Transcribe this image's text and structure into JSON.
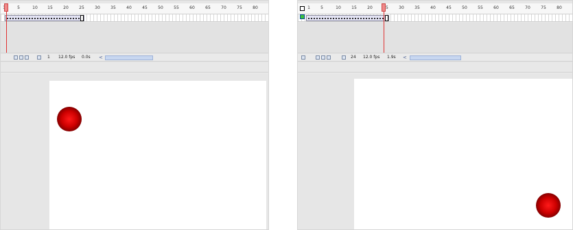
{
  "timeline": {
    "ruler_labels": [
      "1",
      "5",
      "10",
      "15",
      "20",
      "25",
      "30",
      "35",
      "40",
      "45",
      "50",
      "55",
      "60",
      "65",
      "70",
      "75",
      "80"
    ]
  },
  "panels": [
    {
      "current_frame": "1",
      "frame_rate": "12.0 fps",
      "elapsed_time": "0.0s",
      "scroll_arrow": "<"
    },
    {
      "current_frame": "24",
      "frame_rate": "12.0 fps",
      "elapsed_time": "1.9s",
      "scroll_arrow": "<"
    }
  ],
  "colors": {
    "ball": "#cc0000",
    "playhead": "#e03030",
    "tween_span": "#e3e3f4",
    "keyframe_box": "#3ac13a"
  },
  "icons": [
    "playhead-marker-icon",
    "onion-skin-icon",
    "onion-skin-outline-icon",
    "edit-multiple-frames-icon",
    "modify-onion-markers-icon",
    "layer-icon"
  ]
}
